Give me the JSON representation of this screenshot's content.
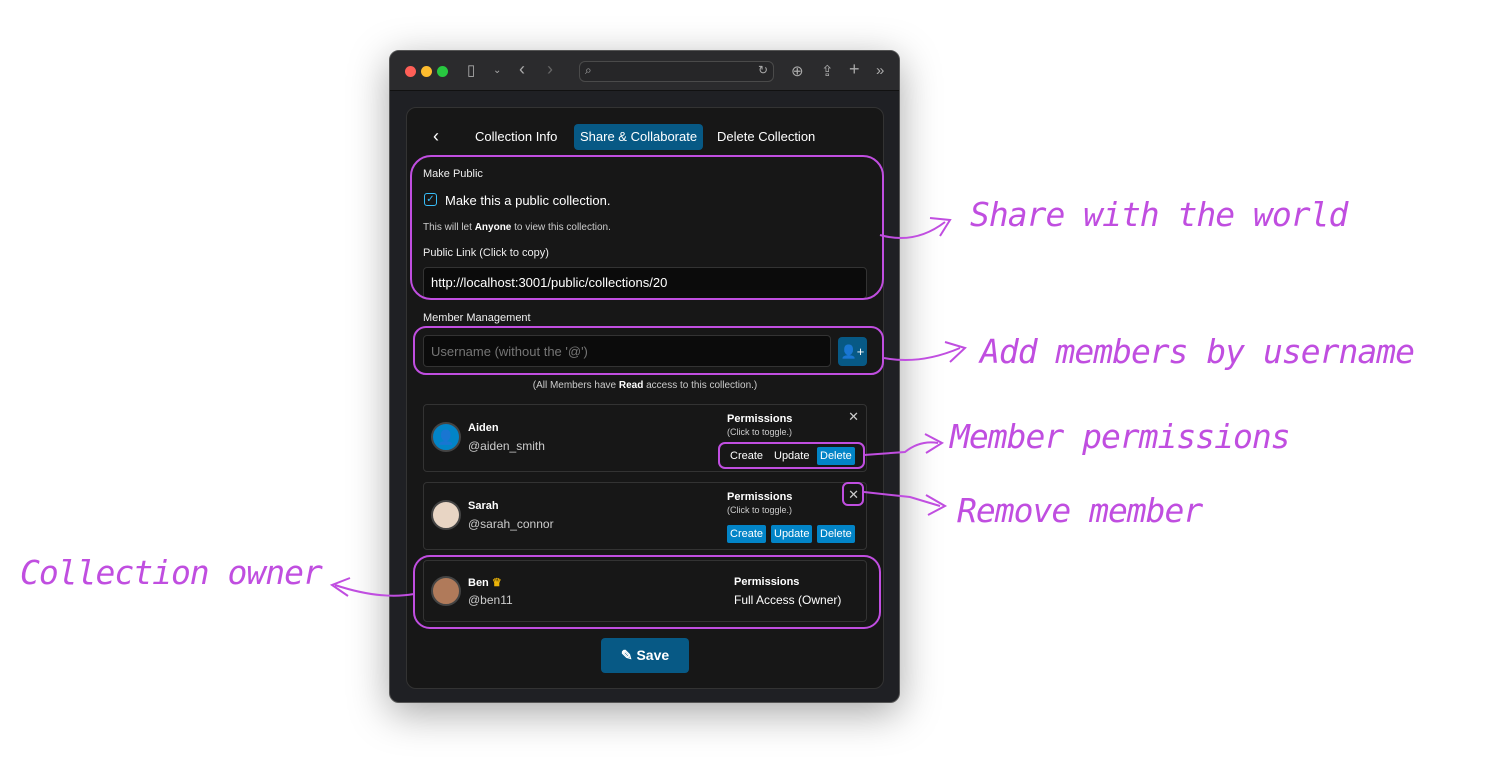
{
  "browser": {
    "controls": [
      "close",
      "minimize",
      "zoom"
    ],
    "url": ""
  },
  "tabs": {
    "back": "‹",
    "items": [
      "Collection Info",
      "Share & Collaborate",
      "Delete Collection"
    ],
    "active": "Share & Collaborate"
  },
  "make_public": {
    "heading": "Make Public",
    "checkbox_label": "Make this a public collection.",
    "checked": true,
    "desc_pre": "This will let ",
    "desc_bold": "Anyone",
    "desc_post": " to view this collection.",
    "link_label": "Public Link (Click to copy)",
    "link_value": "http://localhost:3001/public/collections/20"
  },
  "members": {
    "heading": "Member Management",
    "placeholder": "Username (without the '@')",
    "note_pre": "(All Members have ",
    "note_bold": "Read",
    "note_post": " access to this collection.)",
    "list": [
      {
        "name": "Aiden",
        "username": "@aiden_smith",
        "perm_heading": "Permissions",
        "perm_hint": "(Click to toggle.)",
        "perms": [
          {
            "label": "Create",
            "on": false
          },
          {
            "label": "Update",
            "on": false
          },
          {
            "label": "Delete",
            "on": true
          }
        ]
      },
      {
        "name": "Sarah",
        "username": "@sarah_connor",
        "perm_heading": "Permissions",
        "perm_hint": "(Click to toggle.)",
        "perms": [
          {
            "label": "Create",
            "on": true
          },
          {
            "label": "Update",
            "on": true
          },
          {
            "label": "Delete",
            "on": true
          }
        ]
      }
    ],
    "owner": {
      "name": "Ben",
      "username": "@ben11",
      "perm_heading": "Permissions",
      "perm_value": "Full Access (Owner)"
    }
  },
  "save_label": "Save",
  "annotations": {
    "share": "Share with the world",
    "add": "Add members by username",
    "perms": "Member permissions",
    "remove": "Remove member",
    "owner": "Collection owner"
  },
  "colors": {
    "accent": "#0284c7",
    "active_tab": "#075985",
    "annotation": "#c04ee0",
    "crown": "#eab308"
  }
}
